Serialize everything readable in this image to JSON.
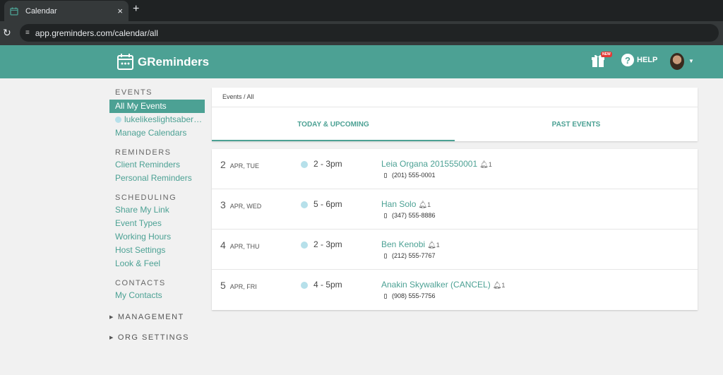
{
  "browser": {
    "tab_title": "Calendar",
    "tab_close": "×",
    "new_tab": "+",
    "url": "app.greminders.com/calendar/all"
  },
  "header": {
    "logo_text": "GReminders",
    "new_badge": "NEW",
    "help_label": "HELP",
    "help_icon": "?",
    "accent_color": "#4ca194"
  },
  "sidebar": {
    "events_heading": "EVENTS",
    "events_items": [
      {
        "label": "All My Events",
        "active": true
      },
      {
        "label": "lukelikeslightsabers..."
      },
      {
        "label": "Manage Calendars"
      }
    ],
    "reminders_heading": "REMINDERS",
    "reminders_items": [
      {
        "label": "Client Reminders"
      },
      {
        "label": "Personal Reminders"
      }
    ],
    "scheduling_heading": "SCHEDULING",
    "scheduling_items": [
      {
        "label": "Share My Link"
      },
      {
        "label": "Event Types"
      },
      {
        "label": "Working Hours"
      },
      {
        "label": "Host Settings"
      },
      {
        "label": "Look & Feel"
      }
    ],
    "contacts_heading": "CONTACTS",
    "contacts_items": [
      {
        "label": "My Contacts"
      }
    ],
    "management_label": "MANAGEMENT",
    "org_settings_label": "ORG SETTINGS"
  },
  "main": {
    "breadcrumb": "Events / All",
    "tabs": [
      {
        "label": "TODAY & UPCOMING",
        "active": true
      },
      {
        "label": "PAST EVENTS"
      }
    ],
    "events": [
      {
        "day": "2",
        "month_day": "APR, TUE",
        "time": "2 - 3pm",
        "name": "Leia Organa 2015550001",
        "reminders": "1",
        "phone": "(201) 555-0001"
      },
      {
        "day": "3",
        "month_day": "APR, WED",
        "time": "5 - 6pm",
        "name": "Han Solo",
        "reminders": "1",
        "phone": "(347) 555-8886"
      },
      {
        "day": "4",
        "month_day": "APR, THU",
        "time": "2 - 3pm",
        "name": "Ben Kenobi",
        "reminders": "1",
        "phone": "(212) 555-7767"
      },
      {
        "day": "5",
        "month_day": "APR, FRI",
        "time": "4 - 5pm",
        "name": "Anakin Skywalker (CANCEL)",
        "reminders": "1",
        "phone": "(908) 555-7756"
      }
    ]
  }
}
